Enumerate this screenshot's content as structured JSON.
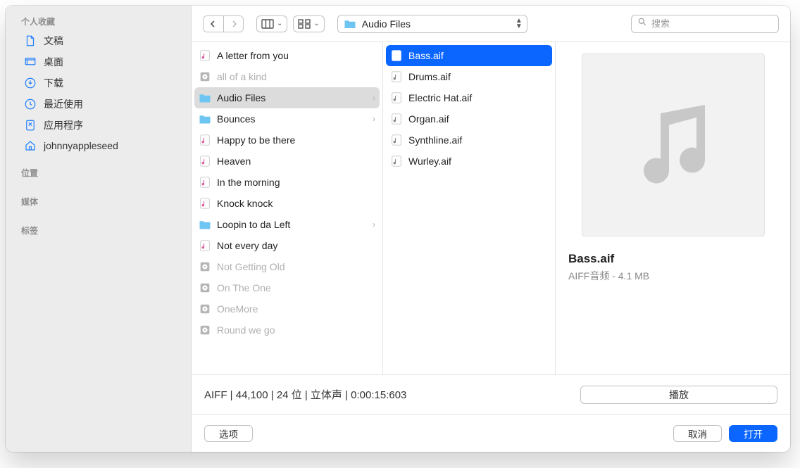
{
  "sidebar": {
    "sections": {
      "favorites": {
        "title": "个人收藏"
      },
      "locations": {
        "title": "位置"
      },
      "media": {
        "title": "媒体"
      },
      "tags": {
        "title": "标签"
      }
    },
    "items": [
      {
        "name": "documents",
        "icon": "document-icon",
        "label": "文稿"
      },
      {
        "name": "desktop",
        "icon": "desktop-icon",
        "label": "桌面"
      },
      {
        "name": "downloads",
        "icon": "downloads-icon",
        "label": "下载"
      },
      {
        "name": "recents",
        "icon": "clock-icon",
        "label": "最近使用"
      },
      {
        "name": "applications",
        "icon": "app-icon",
        "label": "应用程序"
      },
      {
        "name": "home",
        "icon": "home-icon",
        "label": "johnnyappleseed"
      }
    ]
  },
  "toolbar": {
    "path_label": "Audio Files",
    "search_placeholder": "搜索"
  },
  "columns": {
    "col1": [
      {
        "type": "music",
        "label": "A letter from you"
      },
      {
        "type": "disk",
        "label": "all of a kind",
        "dim": true
      },
      {
        "type": "folder",
        "label": "Audio Files",
        "selected": "gray",
        "hasChildren": true
      },
      {
        "type": "folder",
        "label": "Bounces",
        "hasChildren": true
      },
      {
        "type": "music",
        "label": "Happy to be there"
      },
      {
        "type": "music",
        "label": "Heaven"
      },
      {
        "type": "music",
        "label": "In the morning"
      },
      {
        "type": "music",
        "label": "Knock knock"
      },
      {
        "type": "folder",
        "label": "Loopin to da Left",
        "hasChildren": true
      },
      {
        "type": "music",
        "label": "Not every day"
      },
      {
        "type": "disk",
        "label": "Not Getting Old",
        "dim": true
      },
      {
        "type": "disk",
        "label": "On The One",
        "dim": true
      },
      {
        "type": "disk",
        "label": "OneMore",
        "dim": true
      },
      {
        "type": "disk",
        "label": "Round we go",
        "dim": true
      }
    ],
    "col2": [
      {
        "type": "audio",
        "label": "Bass.aif",
        "selected": "blue"
      },
      {
        "type": "audio",
        "label": "Drums.aif"
      },
      {
        "type": "audio",
        "label": "Electric Hat.aif"
      },
      {
        "type": "audio",
        "label": "Organ.aif"
      },
      {
        "type": "audio",
        "label": "Synthline.aif"
      },
      {
        "type": "audio",
        "label": "Wurley.aif"
      }
    ]
  },
  "preview": {
    "filename": "Bass.aif",
    "subtitle": "AIFF音频 - 4.1 MB"
  },
  "status": {
    "text": "AIFF  |  44,100  |  24 位  |  立体声  |  0:00:15:603",
    "play_label": "播放"
  },
  "actions": {
    "options": "选项",
    "cancel": "取消",
    "open": "打开"
  }
}
